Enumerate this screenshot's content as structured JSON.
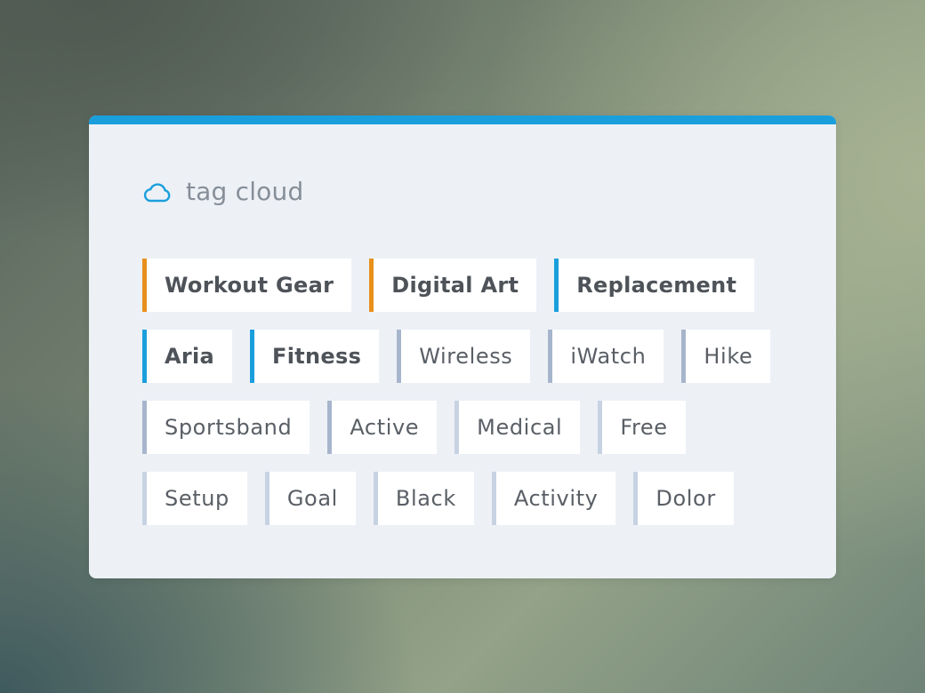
{
  "widget": {
    "title": "tag cloud",
    "icon": "cloud-icon",
    "accent_color": "#1a9fdc"
  },
  "tag_rows": [
    [
      {
        "label": "Workout Gear",
        "weight": "bold",
        "accent": "orange"
      },
      {
        "label": "Digital Art",
        "weight": "bold",
        "accent": "orange"
      },
      {
        "label": "Replacement",
        "weight": "bold",
        "accent": "blue"
      }
    ],
    [
      {
        "label": "Aria",
        "weight": "bold",
        "accent": "blue"
      },
      {
        "label": "Fitness",
        "weight": "bold",
        "accent": "blue"
      },
      {
        "label": "Wireless",
        "weight": "regular",
        "accent": "slate"
      },
      {
        "label": "iWatch",
        "weight": "regular",
        "accent": "slate"
      },
      {
        "label": "Hike",
        "weight": "regular",
        "accent": "slate"
      }
    ],
    [
      {
        "label": "Sportsband",
        "weight": "regular",
        "accent": "slate"
      },
      {
        "label": "Active",
        "weight": "regular",
        "accent": "slate"
      },
      {
        "label": "Medical",
        "weight": "regular",
        "accent": "light"
      },
      {
        "label": "Free",
        "weight": "regular",
        "accent": "light"
      }
    ],
    [
      {
        "label": "Setup",
        "weight": "regular",
        "accent": "light"
      },
      {
        "label": "Goal",
        "weight": "regular",
        "accent": "light"
      },
      {
        "label": "Black",
        "weight": "regular",
        "accent": "light"
      },
      {
        "label": "Activity",
        "weight": "regular",
        "accent": "light"
      },
      {
        "label": "Dolor",
        "weight": "regular",
        "accent": "light"
      }
    ]
  ],
  "colors": {
    "orange": "#e8901c",
    "blue": "#1a9fdc",
    "slate": "#a7b5cc",
    "light": "#c7d2e2",
    "card_background": "#edf1f6"
  }
}
